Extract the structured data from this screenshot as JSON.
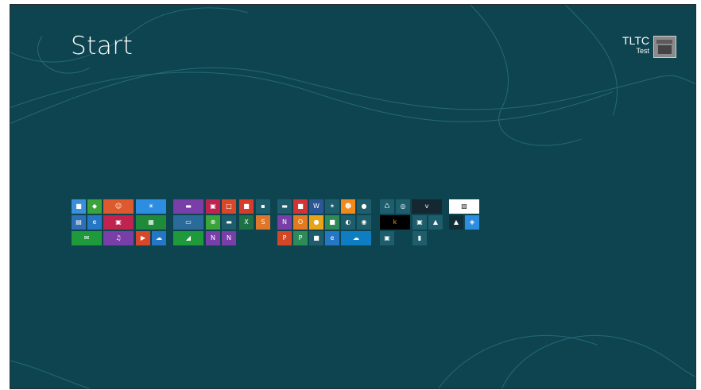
{
  "start": {
    "title": "Start",
    "user": {
      "name": "TLTC",
      "sub": "Test"
    }
  },
  "colors": {
    "background": "#0e4450",
    "swirl": "#2d7a86"
  },
  "tiles": [
    {
      "name": "store-tile",
      "icon": "store-icon",
      "glyph": "■",
      "color": "#3a8fdb"
    },
    {
      "name": "games-tile",
      "icon": "gamepad-icon",
      "glyph": "◆",
      "color": "#3aa339"
    },
    {
      "name": "people-tile",
      "icon": "people-icon",
      "glyph": "☺",
      "color": "#dd5a2e"
    },
    {
      "name": "weather-tile",
      "icon": "sun-icon",
      "glyph": "☀",
      "color": "#2d8de0"
    },
    {
      "name": "messaging-tile",
      "icon": "chat-icon",
      "glyph": "▬",
      "color": "#7a3ea9"
    },
    {
      "name": "camera-tile",
      "icon": "camera-icon",
      "glyph": "▣",
      "color": "#c0234f"
    },
    {
      "name": "remote-desktop-tile",
      "icon": "remote-icon",
      "glyph": "□",
      "color": "#d9472b"
    },
    {
      "name": "app-tile-1",
      "icon": "app-icon",
      "glyph": "■",
      "color": "#d83b2a"
    },
    {
      "name": "app-tile-2",
      "icon": "app-icon",
      "glyph": "▪",
      "color": "#1e5d6b"
    },
    {
      "name": "app-tile-3",
      "icon": "app-icon",
      "glyph": "▬",
      "color": "#1e5d6b"
    },
    {
      "name": "app-tile-4",
      "icon": "app-icon",
      "glyph": "■",
      "color": "#d13438"
    },
    {
      "name": "word-tile",
      "icon": "word-icon",
      "glyph": "W",
      "color": "#2b5797"
    },
    {
      "name": "app-tile-5",
      "icon": "pin-icon",
      "glyph": "✶",
      "color": "#1e5d6b"
    },
    {
      "name": "app-tile-6",
      "icon": "person-icon",
      "glyph": "☻",
      "color": "#f08a1c"
    },
    {
      "name": "app-tile-7",
      "icon": "app-icon",
      "glyph": "●",
      "color": "#1e5d6b"
    },
    {
      "name": "recycle-bin-tile",
      "icon": "recycle-bin-icon",
      "glyph": "♺",
      "color": "#1e5d6b"
    },
    {
      "name": "chrome-tile",
      "icon": "chrome-icon",
      "glyph": "◎",
      "color": "#1e5d6b"
    },
    {
      "name": "vimeo-tile",
      "icon": "vimeo-icon",
      "glyph": "v",
      "color": "#152730"
    },
    {
      "name": "image-tile",
      "icon": "image-icon",
      "glyph": "▧",
      "color": "#ffffff",
      "fg": "#222"
    },
    {
      "name": "news-tile",
      "icon": "news-icon",
      "glyph": "▤",
      "color": "#2f6fb5"
    },
    {
      "name": "ie-tile",
      "icon": "ie-icon",
      "glyph": "e",
      "color": "#2577c5"
    },
    {
      "name": "photos-tile",
      "icon": "photo-icon",
      "glyph": "▣",
      "color": "#c0234f"
    },
    {
      "name": "calculator-tile",
      "icon": "calculator-icon",
      "glyph": "▦",
      "color": "#1e8a3a"
    },
    {
      "name": "desktop-tile",
      "icon": "desktop-icon",
      "glyph": "▭",
      "color": "#2b6b9a"
    },
    {
      "name": "xbox-tile",
      "icon": "xbox-icon",
      "glyph": "⊗",
      "color": "#3aa339"
    },
    {
      "name": "explorer-tile",
      "icon": "folder-icon",
      "glyph": "▬",
      "color": "#1e5d6b"
    },
    {
      "name": "excel-tile",
      "icon": "excel-icon",
      "glyph": "X",
      "color": "#1e7145"
    },
    {
      "name": "sway-tile",
      "icon": "app-icon",
      "glyph": "S",
      "color": "#e0762a"
    },
    {
      "name": "onenote-tile",
      "icon": "onenote-icon",
      "glyph": "N",
      "color": "#7a3ea9"
    },
    {
      "name": "outlook-tile",
      "icon": "outlook-icon",
      "glyph": "O",
      "color": "#e37a1f"
    },
    {
      "name": "app-tile-8",
      "icon": "circle-icon",
      "glyph": "●",
      "color": "#e9a31a"
    },
    {
      "name": "app-tile-9",
      "icon": "app-icon",
      "glyph": "■",
      "color": "#2e8b57"
    },
    {
      "name": "app-tile-10",
      "icon": "app-icon",
      "glyph": "◐",
      "color": "#1e5d6b"
    },
    {
      "name": "app-tile-11",
      "icon": "compass-icon",
      "glyph": "◉",
      "color": "#1e5d6b"
    },
    {
      "name": "kindle-tile",
      "icon": "kindle-icon",
      "glyph": "k",
      "color": "#000000",
      "fg": "#f0a020"
    },
    {
      "name": "app-tile-12",
      "icon": "app-icon",
      "glyph": "▣",
      "color": "#1e5d6b"
    },
    {
      "name": "drive-tile",
      "icon": "drive-icon",
      "glyph": "▲",
      "color": "#1e5d6b"
    },
    {
      "name": "app-tile-13",
      "icon": "hat-icon",
      "glyph": "▲",
      "color": "#0f2e38"
    },
    {
      "name": "app-tile-14",
      "icon": "app-icon",
      "glyph": "◈",
      "color": "#2d8de0"
    },
    {
      "name": "mail-tile",
      "icon": "mail-icon",
      "glyph": "✉",
      "color": "#1e9a3a"
    },
    {
      "name": "music-tile",
      "icon": "headphones-icon",
      "glyph": "♫",
      "color": "#7a3ea9"
    },
    {
      "name": "video-tile",
      "icon": "video-icon",
      "glyph": "▶",
      "color": "#d9472b"
    },
    {
      "name": "skydrive-tile",
      "icon": "cloud-icon",
      "glyph": "☁",
      "color": "#2577c5"
    },
    {
      "name": "finance-tile",
      "icon": "chart-icon",
      "glyph": "◢",
      "color": "#1e9a3a"
    },
    {
      "name": "onenote-tile-2",
      "icon": "onenote-icon",
      "glyph": "N",
      "color": "#7a3ea9"
    },
    {
      "name": "onenote-tile-3",
      "icon": "onenote-icon",
      "glyph": "N",
      "color": "#7a3ea9"
    },
    {
      "name": "powerpoint-tile",
      "icon": "powerpoint-icon",
      "glyph": "P",
      "color": "#d24726"
    },
    {
      "name": "publisher-tile",
      "icon": "publisher-icon",
      "glyph": "P",
      "color": "#2e8b57"
    },
    {
      "name": "app-tile-15",
      "icon": "app-icon",
      "glyph": "■",
      "color": "#1e5d6b"
    },
    {
      "name": "ie-desktop-tile",
      "icon": "ie-icon",
      "glyph": "e",
      "color": "#2577c5"
    },
    {
      "name": "skydrive-wide-tile",
      "icon": "cloud-icon",
      "glyph": "☁",
      "color": "#0f7dc2"
    },
    {
      "name": "app-tile-16",
      "icon": "app-icon",
      "glyph": "▣",
      "color": "#1e5d6b"
    },
    {
      "name": "app-tile-17",
      "icon": "folder-icon",
      "glyph": "▮",
      "color": "#1e5d6b"
    }
  ]
}
